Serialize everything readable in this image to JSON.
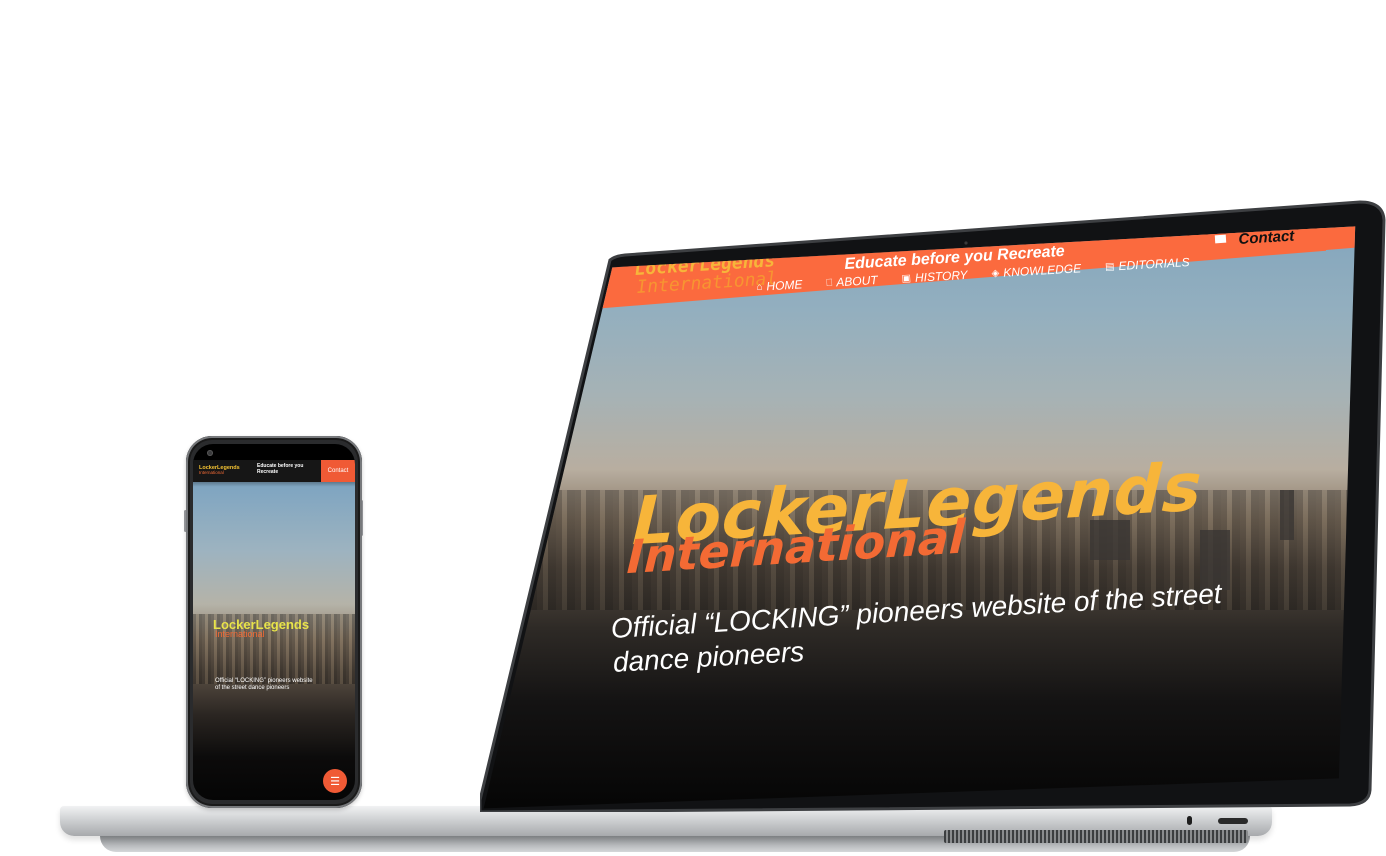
{
  "desktop": {
    "logo_line1": "LockerLegends",
    "logo_line2": "International",
    "tagline": "Educate before you Recreate",
    "contact_label": "Contact",
    "nav": [
      {
        "icon": "home-icon",
        "glyph": "⌂",
        "label": "HOME"
      },
      {
        "icon": "book-icon",
        "glyph": "⎕",
        "label": "ABOUT"
      },
      {
        "icon": "scroll-icon",
        "glyph": "▣",
        "label": "HISTORY"
      },
      {
        "icon": "cube-icon",
        "glyph": "◈",
        "label": "KNOWLEDGE"
      },
      {
        "icon": "document-icon",
        "glyph": "▤",
        "label": "EDITORIALS"
      }
    ],
    "hero_title": "LockerLegends",
    "hero_subtitle": "International",
    "hero_description": "Official “LOCKING” pioneers website of the street dance pioneers"
  },
  "mobile": {
    "logo_line1": "LockerLegends",
    "logo_line2": "International",
    "tagline": "Educate before you Recreate",
    "contact_label": "Contact",
    "hero_title": "LockerLegends",
    "hero_subtitle": "International",
    "hero_description": "Official “LOCKING” pioneers website of the street dance pioneers",
    "menu_glyph": "☰"
  },
  "colors": {
    "accent_orange": "#fb6a3e",
    "logo_yellow": "#f7b53a",
    "header_dark": "#1c1c1c"
  }
}
